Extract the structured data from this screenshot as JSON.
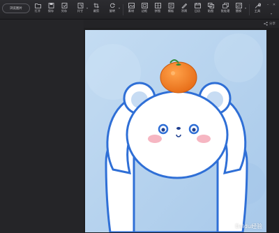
{
  "toolbar": {
    "browse_label": "浏览图片",
    "tools": [
      {
        "label": "打开",
        "icon": "folder-icon"
      },
      {
        "label": "保存",
        "icon": "save-icon"
      },
      {
        "label": "另存",
        "icon": "save-as-icon"
      },
      {
        "label": "尺寸",
        "icon": "resize-icon"
      },
      {
        "label": "裁剪",
        "icon": "crop-icon"
      },
      {
        "label": "旋转",
        "icon": "rotate-icon"
      },
      {
        "label": "素材",
        "icon": "sticker-icon"
      },
      {
        "label": "边框",
        "icon": "frame-icon"
      },
      {
        "label": "拼图",
        "icon": "collage-icon"
      },
      {
        "label": "模板",
        "icon": "template-icon"
      },
      {
        "label": "涂鸦",
        "icon": "doodle-icon"
      },
      {
        "label": "日历",
        "icon": "calendar-icon"
      },
      {
        "label": "贴图",
        "icon": "paste-icon"
      },
      {
        "label": "批处理",
        "icon": "batch-icon"
      },
      {
        "label": "替换",
        "icon": "replace-icon"
      },
      {
        "label": "工具",
        "icon": "tools-icon"
      }
    ]
  },
  "share_label": "分享",
  "watermark": "Baidu经验",
  "colors": {
    "sky": "#b8d4ee",
    "bear_outline": "#2f6fd6",
    "tangerine": "#f07a22",
    "cheek": "#f6b6c2"
  }
}
